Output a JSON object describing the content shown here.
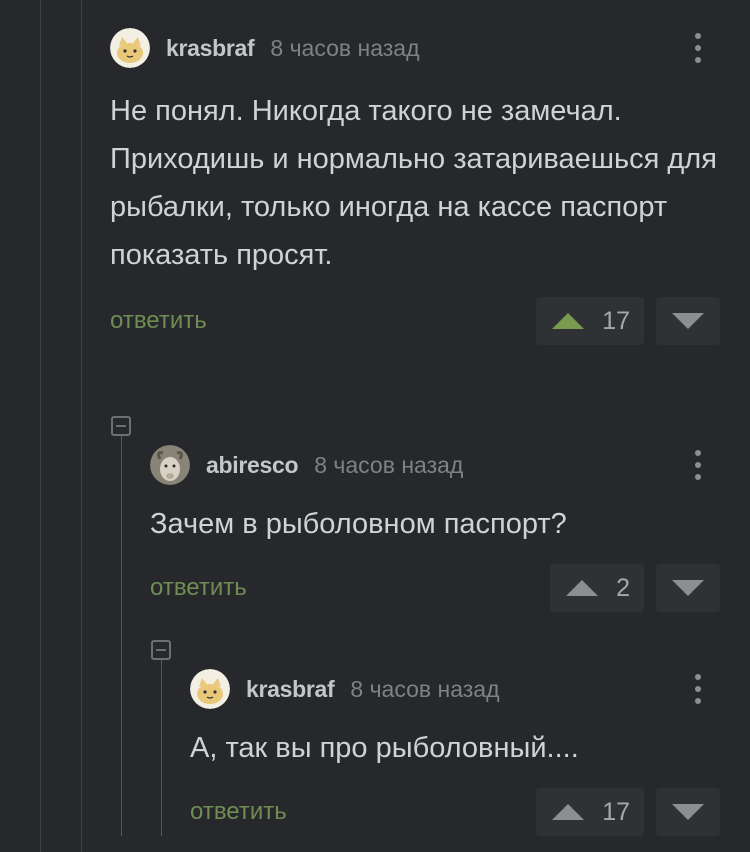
{
  "comments": [
    {
      "username": "krasbraf",
      "time": "8 часов назад",
      "text": "Не понял. Никогда такого не замечал. Приходишь и нормально затариваешься для рыбалки, только иногда на кассе паспорт показать просят.",
      "reply_label": "ответить",
      "score": "17",
      "upvoted": true
    },
    {
      "username": "abiresco",
      "time": "8 часов назад",
      "text": "Зачем в рыболовном паспорт?",
      "reply_label": "ответить",
      "score": "2",
      "upvoted": false
    },
    {
      "username": "krasbraf",
      "time": "8 часов назад",
      "text": "А, так вы про рыболовный....",
      "reply_label": "ответить",
      "score": "17",
      "upvoted": false
    }
  ],
  "colors": {
    "background": "#26282b",
    "reply_link": "#6f8c55",
    "upvote_active": "#7a9c4e"
  },
  "icons": [
    "avatar-cat-icon",
    "avatar-goat-icon",
    "more-vertical-icon",
    "upvote-icon",
    "downvote-icon",
    "collapse-thread-icon"
  ]
}
